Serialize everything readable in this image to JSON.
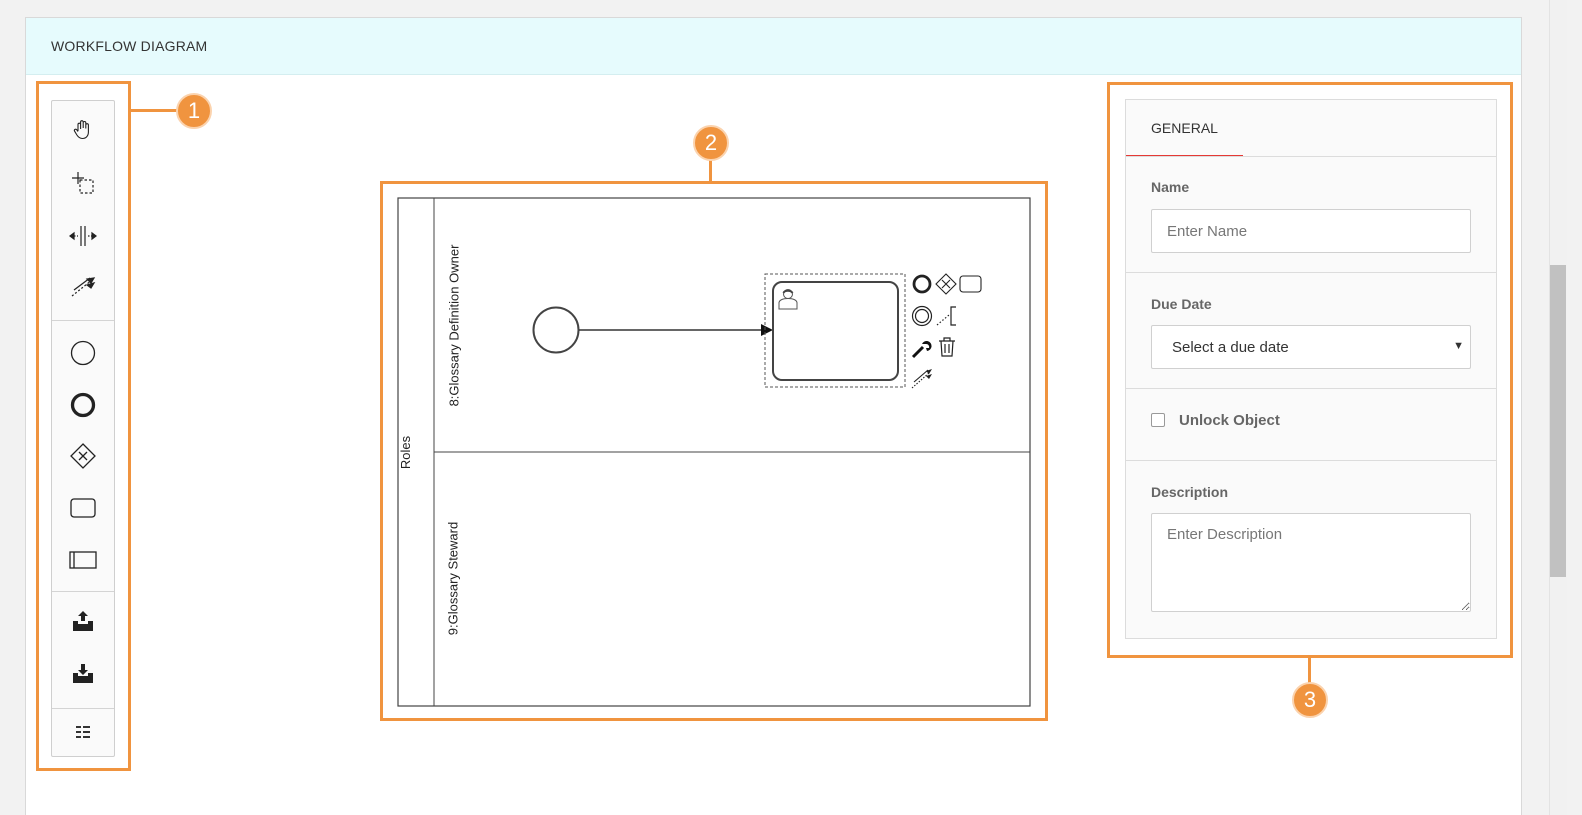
{
  "header": {
    "title": "WORKFLOW DIAGRAM"
  },
  "callouts": [
    "1",
    "2",
    "3"
  ],
  "palette": {
    "tools": [
      {
        "name": "hand-tool",
        "icon": "hand-icon"
      },
      {
        "name": "lasso-tool",
        "icon": "lasso-icon"
      },
      {
        "name": "space-tool",
        "icon": "space-icon"
      },
      {
        "name": "connect-tool",
        "icon": "connect-arrow-icon"
      },
      {
        "name": "start-event",
        "icon": "circle-thin-icon"
      },
      {
        "name": "end-event",
        "icon": "circle-bold-icon"
      },
      {
        "name": "gateway",
        "icon": "gateway-x-icon"
      },
      {
        "name": "task",
        "icon": "rounded-rect-icon"
      },
      {
        "name": "pool",
        "icon": "pool-rect-icon"
      },
      {
        "name": "export",
        "icon": "upload-tray-icon"
      },
      {
        "name": "import",
        "icon": "download-tray-icon"
      },
      {
        "name": "list-view",
        "icon": "list-icon"
      }
    ]
  },
  "diagram": {
    "pool_label": "Roles",
    "lanes": [
      {
        "label": "8:Glossary Definition Owner"
      },
      {
        "label": "9:Glossary Steward"
      }
    ],
    "context_pad": [
      "end-event-icon",
      "gateway-icon",
      "task-icon",
      "intermediate-event-icon",
      "annotation-icon",
      "wrench-icon",
      "trash-icon",
      "connect-icon"
    ]
  },
  "properties": {
    "tab_label": "GENERAL",
    "name_label": "Name",
    "name_placeholder": "Enter Name",
    "due_date_label": "Due Date",
    "due_date_value": "Select a due date",
    "unlock_label": "Unlock Object",
    "unlock_checked": false,
    "description_label": "Description",
    "description_placeholder": "Enter Description"
  },
  "colors": {
    "highlight": "#f0943f",
    "header_bg": "#e6fbfd",
    "tab_accent": "#e53935"
  }
}
